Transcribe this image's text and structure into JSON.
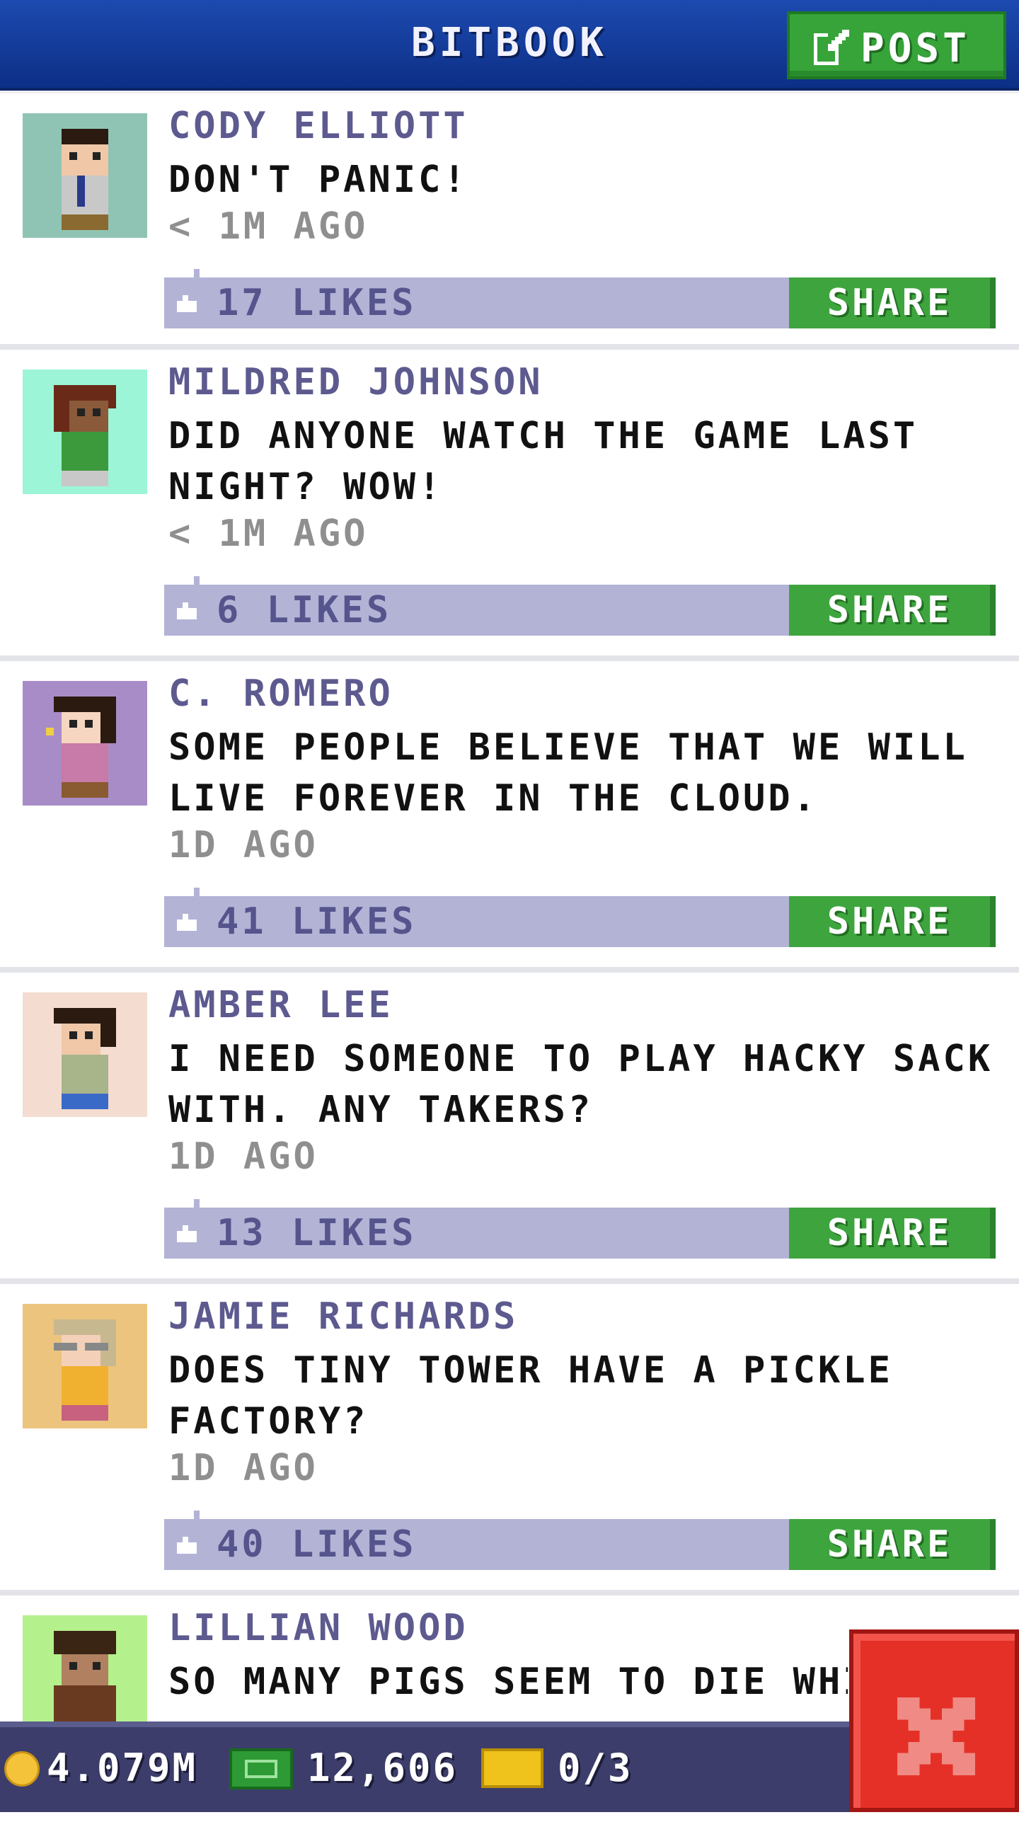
{
  "header": {
    "title": "BITBOOK",
    "post_label": "POST"
  },
  "posts": [
    {
      "author": "CODY ELLIOTT",
      "text": "DON'T PANIC!",
      "time": "< 1M AGO",
      "likes": "17 LIKES",
      "share": "SHARE",
      "avatar_bg": "#8fc4b4",
      "skin": "#f0c8a8",
      "hair": "#2a1a10",
      "shirt": "#c8c8c8"
    },
    {
      "author": "MILDRED JOHNSON",
      "text": "DID ANYONE WATCH THE GAME LAST NIGHT? WOW!",
      "time": "< 1M AGO",
      "likes": "6 LIKES",
      "share": "SHARE",
      "avatar_bg": "#9cf5d6",
      "skin": "#8a5a3a",
      "hair": "#6a2a18",
      "shirt": "#3c9a3c"
    },
    {
      "author": "C. ROMERO",
      "text": "SOME PEOPLE BELIEVE THAT WE WILL LIVE FOREVER IN THE CLOUD.",
      "time": "1D AGO",
      "likes": "41 LIKES",
      "share": "SHARE",
      "avatar_bg": "#a88cc8",
      "skin": "#f6d6c0",
      "hair": "#2a1a10",
      "shirt": "#c87aa8"
    },
    {
      "author": "AMBER LEE",
      "text": "I NEED SOMEONE TO PLAY HACKY SACK WITH. ANY TAKERS?",
      "time": "1D AGO",
      "likes": "13 LIKES",
      "share": "SHARE",
      "avatar_bg": "#f4dcd0",
      "skin": "#f0c8a8",
      "hair": "#2a1a10",
      "shirt": "#a8b48a"
    },
    {
      "author": "JAMIE RICHARDS",
      "text": "DOES TINY TOWER HAVE A PICKLE FACTORY?",
      "time": "1D AGO",
      "likes": "40 LIKES",
      "share": "SHARE",
      "avatar_bg": "#ecc47e",
      "skin": "#f4d0b8",
      "hair": "#c8b890",
      "shirt": "#f0b030"
    },
    {
      "author": "LILLIAN WOOD",
      "text": "SO MANY PIGS SEEM TO DIE WHI",
      "time": "",
      "likes": "",
      "share": "",
      "avatar_bg": "#b4f08c",
      "skin": "#b08060",
      "hair": "#3a2414",
      "shirt": "#6a3a20"
    }
  ],
  "status": {
    "coins": "4.079M",
    "bux": "12,606",
    "tickets": "0/3"
  },
  "colors": {
    "header": "#1a44a8",
    "post_btn": "#37a43a",
    "like_bar": "#b3b3d6",
    "share_btn": "#3ea53e",
    "status_bar": "#3c3d6a",
    "close_btn": "#e53027"
  }
}
